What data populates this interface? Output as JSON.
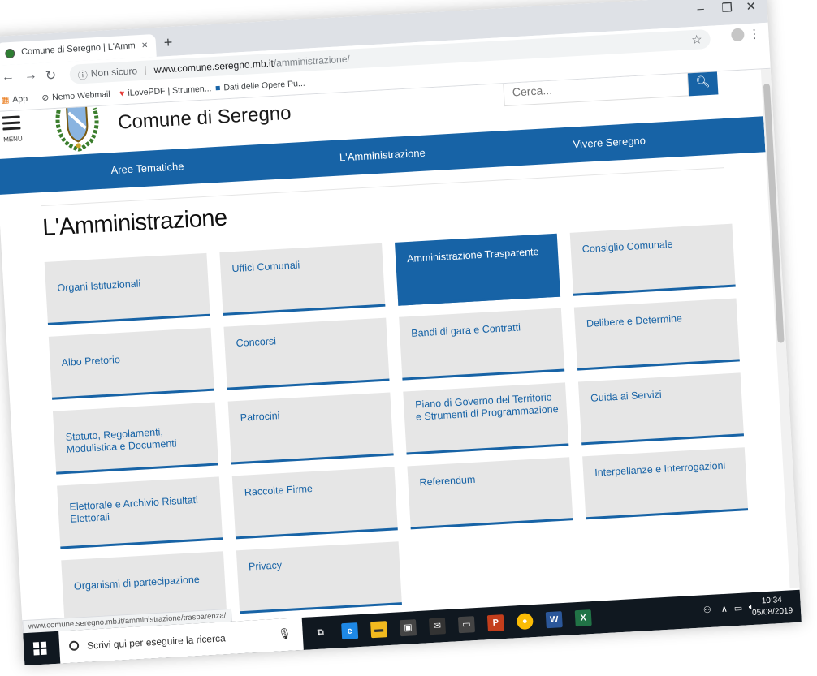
{
  "browser": {
    "tab_title": "Comune di Seregno | L'Amministr",
    "tab_close": "×",
    "new_tab": "+",
    "url_security": "Non sicuro",
    "url_host": "www.comune.seregno.mb.it",
    "url_path": "/amministrazione/",
    "bookmarks": [
      "App",
      "Nemo Webmail",
      "iLovePDF | Strumen...",
      "Dati delle Opere Pu..."
    ]
  },
  "header": {
    "menu_label": "MENU",
    "site_title": "Comune di Seregno",
    "search_placeholder": "Cerca..."
  },
  "nav": {
    "items": [
      "Aree Tematiche",
      "L'Amministrazione",
      "Vivere Seregno"
    ]
  },
  "main": {
    "page_title": "L'Amministrazione",
    "tiles": [
      {
        "label": "Organi Istituzionali"
      },
      {
        "label": "Uffici Comunali"
      },
      {
        "label": "Amministrazione Trasparente"
      },
      {
        "label": "Consiglio Comunale"
      },
      {
        "label": "Albo Pretorio"
      },
      {
        "label": "Concorsi"
      },
      {
        "label": "Bandi di gara e Contratti"
      },
      {
        "label": "Delibere e Determine"
      },
      {
        "label": "Statuto, Regolamenti, Modulistica e Documenti"
      },
      {
        "label": "Patrocini"
      },
      {
        "label": "Piano di Governo del Territorio e Strumenti di Programmazione"
      },
      {
        "label": "Guida ai Servizi"
      },
      {
        "label": "Elettorale e Archivio Risultati Elettorali"
      },
      {
        "label": "Raccolte Firme"
      },
      {
        "label": "Referendum"
      },
      {
        "label": "Interpellanze e Interrogazioni"
      },
      {
        "label": "Organismi di partecipazione"
      },
      {
        "label": "Privacy"
      }
    ]
  },
  "status_url": "www.comune.seregno.mb.it/amministrazione/trasparenza/",
  "taskbar": {
    "search_text": "Scrivi qui per eseguire la ricerca",
    "time": "10:34",
    "date": "05/08/2019"
  },
  "colors": {
    "brand_blue": "#1763a6",
    "tile_gray": "#e6e6e6"
  }
}
